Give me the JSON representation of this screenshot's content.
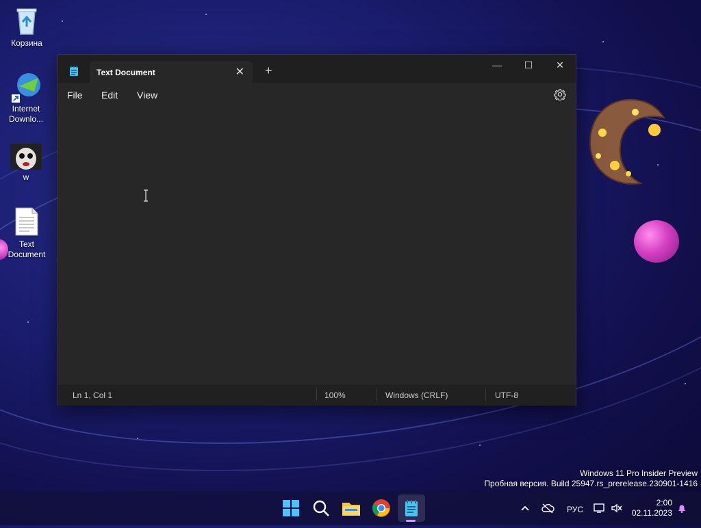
{
  "desktop": {
    "icons": [
      {
        "label": "Корзина"
      },
      {
        "label": "Internet Downlo..."
      },
      {
        "label": "w"
      },
      {
        "label": "Text Document"
      }
    ]
  },
  "window": {
    "tab_title": "Text Document",
    "tab_close_glyph": "✕",
    "tab_add_glyph": "+",
    "minimize_glyph": "—",
    "maximize_glyph": "☐",
    "close_glyph": "✕"
  },
  "menu": {
    "file": "File",
    "edit": "Edit",
    "view": "View"
  },
  "status": {
    "position": "Ln 1, Col 1",
    "zoom": "100%",
    "line_ending": "Windows (CRLF)",
    "encoding": "UTF-8"
  },
  "watermark": {
    "line1": "Windows 11 Pro Insider Preview",
    "line2": "Пробная версия. Build 25947.rs_prerelease.230901-1416"
  },
  "taskbar": {
    "language": "РУС",
    "time": "2:00",
    "date": "02.11.2023"
  },
  "colors": {
    "window_bg": "#272727",
    "titlebar_bg": "#1f1f1f",
    "accent": "#4cc2ff"
  }
}
